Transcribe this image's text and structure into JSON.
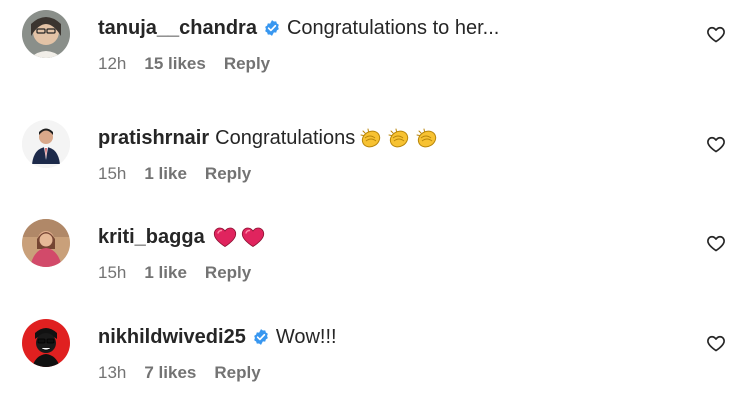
{
  "comments": [
    {
      "username": "tanuja__chandra",
      "verified": true,
      "text": "Congratulations to her...",
      "emojis": [],
      "time": "12h",
      "likes": "15 likes",
      "reply": "Reply"
    },
    {
      "username": "pratishrnair",
      "verified": false,
      "text": "Congratulations",
      "emojis": [
        "clapping-hands",
        "clapping-hands",
        "clapping-hands"
      ],
      "time": "15h",
      "likes": "1 like",
      "reply": "Reply"
    },
    {
      "username": "kriti_bagga",
      "verified": false,
      "text": "",
      "emojis": [
        "red-heart",
        "red-heart"
      ],
      "time": "15h",
      "likes": "1 like",
      "reply": "Reply"
    },
    {
      "username": "nikhildwivedi25",
      "verified": true,
      "text": "Wow!!!",
      "emojis": [],
      "time": "13h",
      "likes": "7 likes",
      "reply": "Reply"
    }
  ],
  "colors": {
    "text": "#262626",
    "meta": "#737373",
    "verified": "#3897f0",
    "heart_emoji": "#e0245e"
  }
}
